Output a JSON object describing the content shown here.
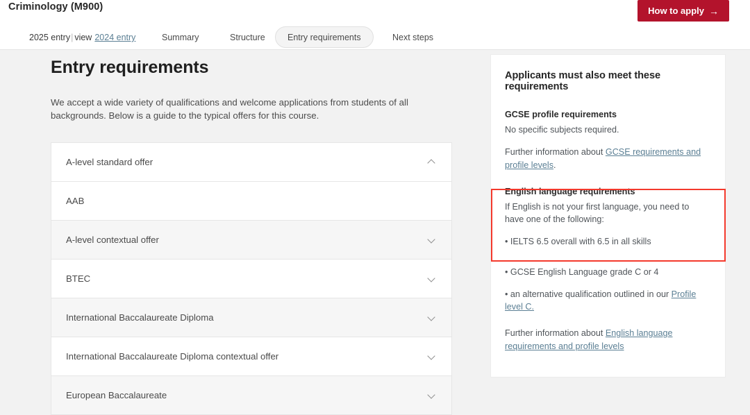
{
  "header": {
    "course_title": "Criminology (M900)",
    "apply_button": "How to apply",
    "apply_arrow": "→"
  },
  "tabs": {
    "entry_year_current": "2025 entry",
    "entry_year_separator": "|",
    "entry_year_view_label": "view",
    "entry_year_link": "2024 entry",
    "items": [
      {
        "label": "Summary",
        "active": false
      },
      {
        "label": "Structure",
        "active": false
      },
      {
        "label": "Entry requirements",
        "active": true
      },
      {
        "label": "Next steps",
        "active": false
      }
    ]
  },
  "main": {
    "page_title": "Entry requirements",
    "intro": "We accept a wide variety of qualifications and welcome applications from students of all backgrounds. Below is a guide to the typical offers for this course.",
    "accordion": [
      {
        "label": "A-level standard offer",
        "expanded": true,
        "chevron": "chevron-up-icon",
        "content": "AAB"
      },
      {
        "label": "A-level contextual offer",
        "expanded": false,
        "chevron": "chevron-down-icon"
      },
      {
        "label": "BTEC",
        "expanded": false,
        "chevron": "chevron-down-icon"
      },
      {
        "label": "International Baccalaureate Diploma",
        "expanded": false,
        "chevron": "chevron-down-icon"
      },
      {
        "label": "International Baccalaureate Diploma contextual offer",
        "expanded": false,
        "chevron": "chevron-down-icon"
      },
      {
        "label": "European Baccalaureate",
        "expanded": false,
        "chevron": "chevron-down-icon"
      }
    ]
  },
  "sidebar": {
    "title": "Applicants must also meet these requirements",
    "gcse": {
      "heading": "GCSE profile requirements",
      "body": "No specific subjects required.",
      "further_prefix": "Further information about ",
      "further_link": "GCSE requirements and profile levels",
      "further_suffix": "."
    },
    "english": {
      "heading": "English language requirements",
      "body": "If English is not your first language, you need to have one of the following:",
      "bullet_1": "• IELTS 6.5 overall with 6.5 in all skills",
      "bullet_2": "• GCSE English Language grade C or 4",
      "bullet_3_prefix": "• an alternative qualification outlined in our ",
      "bullet_3_link": "Profile level C.",
      "further_prefix": "Further information about ",
      "further_link": "English language requirements and profile levels"
    }
  },
  "annotation": {
    "highlight_color": "#f4392c",
    "highlight_target": "english-language-requirements"
  },
  "colors": {
    "brand_red": "#b3132c",
    "link_blue": "#5b7f94",
    "page_background": "#f2f2f2",
    "card_background": "#ffffff"
  }
}
